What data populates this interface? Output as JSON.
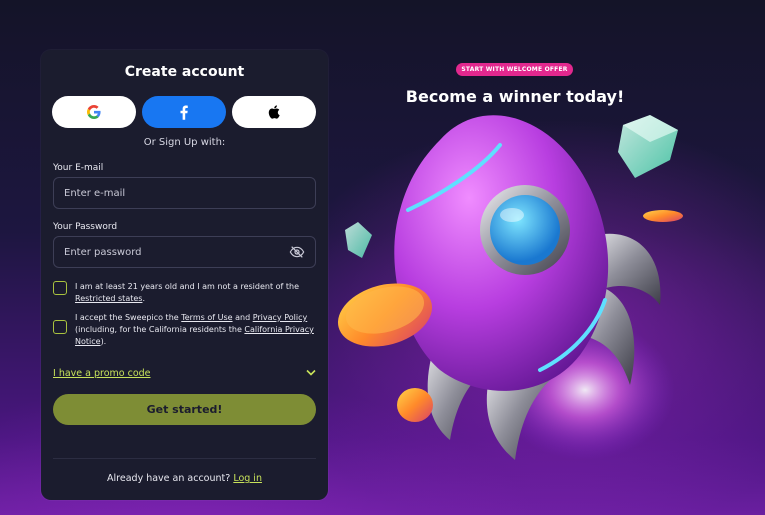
{
  "signup": {
    "title": "Create account",
    "social": {
      "google_icon": "google-icon",
      "facebook_icon": "facebook-icon",
      "apple_icon": "apple-icon"
    },
    "or_text": "Or Sign Up with:",
    "email": {
      "label": "Your E-mail",
      "placeholder": "Enter e-mail",
      "value": ""
    },
    "password": {
      "label": "Your Password",
      "placeholder": "Enter password",
      "value": "",
      "toggle_icon": "eye-slash-icon"
    },
    "age_check": {
      "text": "I am at least 21 years old and I am not a resident of the ",
      "link": "Restricted states",
      "suffix": "."
    },
    "terms_check": {
      "text1": "I accept the Sweepico the ",
      "link1": "Terms of Use",
      "text2": " and ",
      "link2": "Privacy Policy",
      "text3": " (including, for the California residents the ",
      "link3": "California Privacy Notice",
      "text4": ")."
    },
    "promo_label": "I have a promo code",
    "cta_label": "Get started!",
    "login_prompt": "Already have an account? ",
    "login_link": "Log in"
  },
  "promo": {
    "badge": "START WITH WELCOME OFFER",
    "headline": "Become a winner today!"
  },
  "colors": {
    "accent_green": "#c8e25a",
    "cta_bg": "#7e8d35",
    "facebook_blue": "#1877f2",
    "badge_pink": "#e2288e",
    "card_bg": "#1b1c2e"
  }
}
